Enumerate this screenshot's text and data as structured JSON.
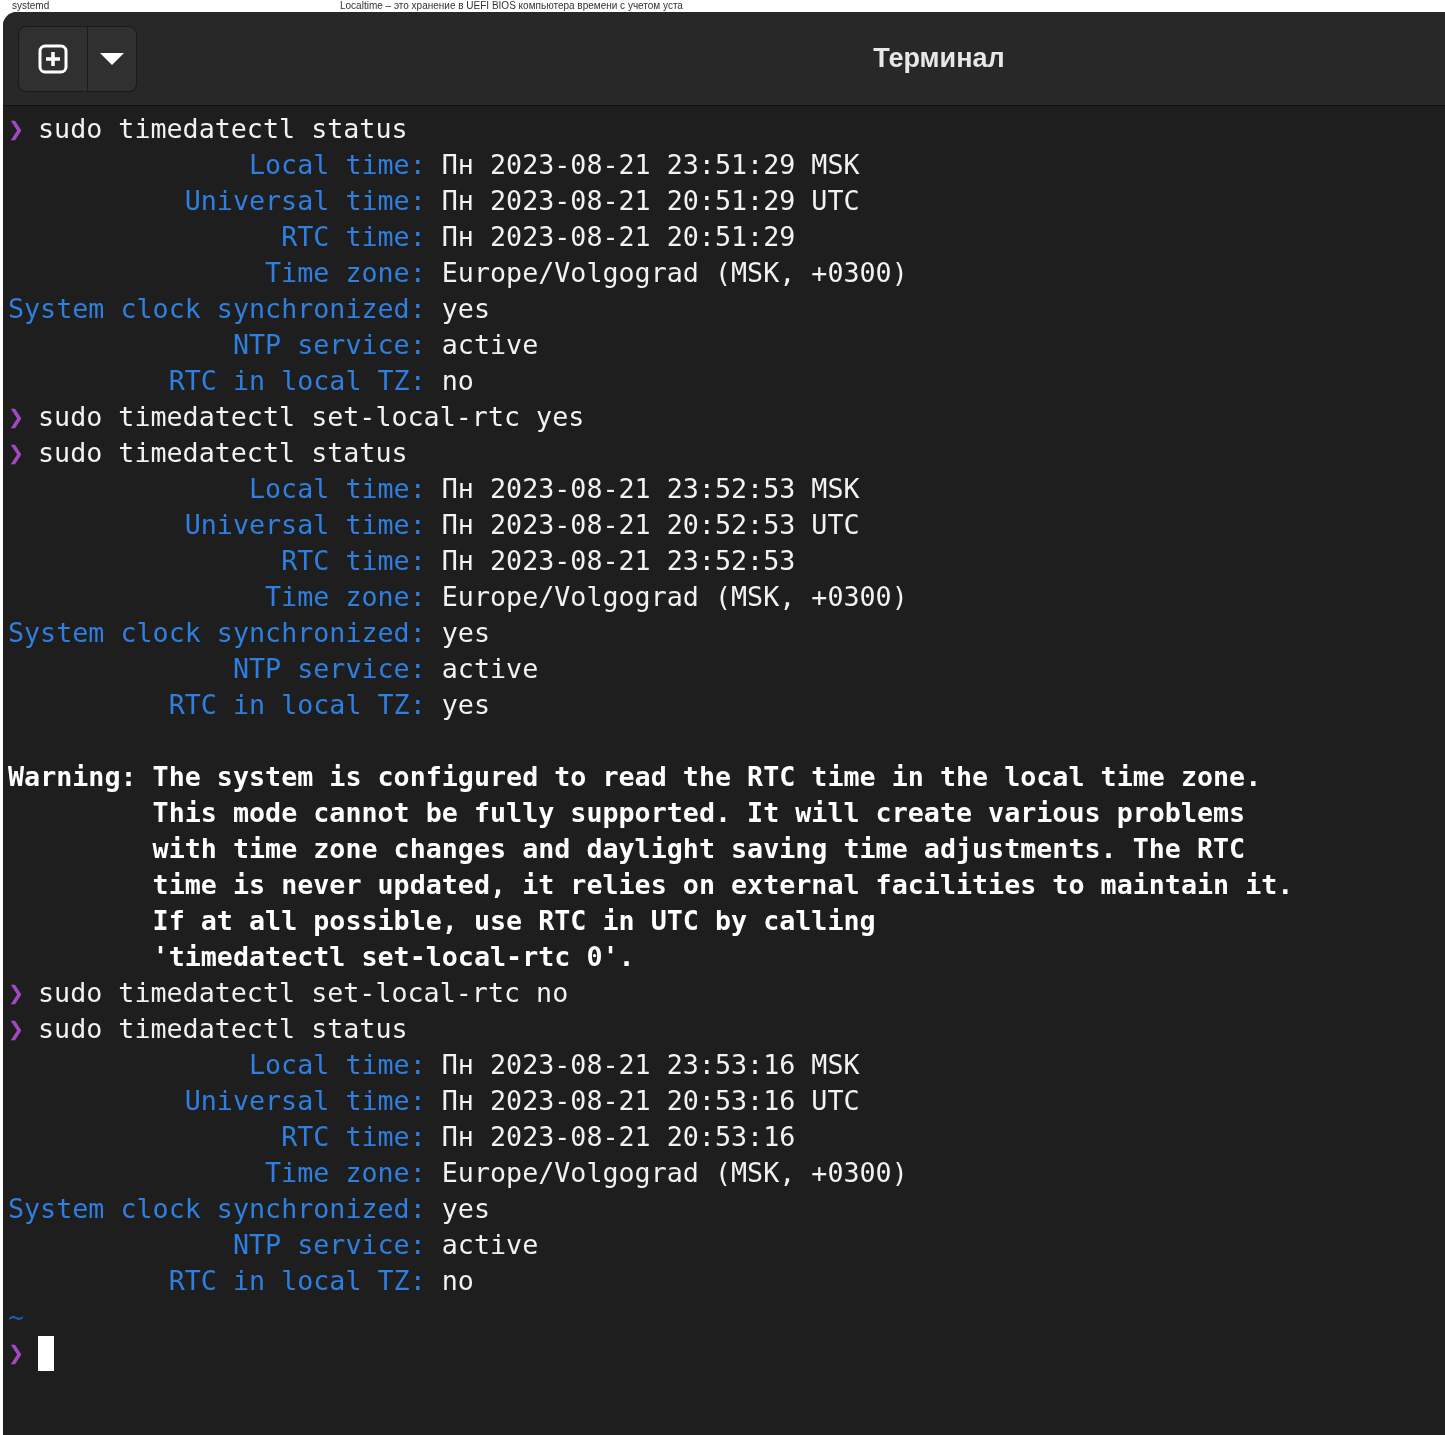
{
  "backdrop": {
    "texts": [
      "systemd",
      "Localtime – это хранение в UEFI BIOS компьютера времени с учетом уста"
    ]
  },
  "window": {
    "title": "Терминал"
  },
  "terminal": {
    "prompt": "❯",
    "lines": [
      {
        "kind": "command",
        "text": "sudo timedatectl status"
      },
      {
        "kind": "field",
        "label": "Local time:",
        "value": "Пн 2023-08-21 23:51:29 MSK"
      },
      {
        "kind": "field",
        "label": "Universal time:",
        "value": "Пн 2023-08-21 20:51:29 UTC"
      },
      {
        "kind": "field",
        "label": "RTC time:",
        "value": "Пн 2023-08-21 20:51:29"
      },
      {
        "kind": "field",
        "label": "Time zone:",
        "value": "Europe/Volgograd (MSK, +0300)"
      },
      {
        "kind": "field",
        "label": "System clock synchronized:",
        "value": "yes"
      },
      {
        "kind": "field",
        "label": "NTP service:",
        "value": "active"
      },
      {
        "kind": "field",
        "label": "RTC in local TZ:",
        "value": "no"
      },
      {
        "kind": "command",
        "text": "sudo timedatectl set-local-rtc yes"
      },
      {
        "kind": "command",
        "text": "sudo timedatectl status"
      },
      {
        "kind": "field",
        "label": "Local time:",
        "value": "Пн 2023-08-21 23:52:53 MSK"
      },
      {
        "kind": "field",
        "label": "Universal time:",
        "value": "Пн 2023-08-21 20:52:53 UTC"
      },
      {
        "kind": "field",
        "label": "RTC time:",
        "value": "Пн 2023-08-21 23:52:53"
      },
      {
        "kind": "field",
        "label": "Time zone:",
        "value": "Europe/Volgograd (MSK, +0300)"
      },
      {
        "kind": "field",
        "label": "System clock synchronized:",
        "value": "yes"
      },
      {
        "kind": "field",
        "label": "NTP service:",
        "value": "active"
      },
      {
        "kind": "field",
        "label": "RTC in local TZ:",
        "value": "yes"
      },
      {
        "kind": "blank"
      },
      {
        "kind": "warning",
        "label": "Warning:",
        "lines": [
          "The system is configured to read the RTC time in the local time zone.",
          "This mode cannot be fully supported. It will create various problems",
          "with time zone changes and daylight saving time adjustments. The RTC",
          "time is never updated, it relies on external facilities to maintain it.",
          "If at all possible, use RTC in UTC by calling",
          "'timedatectl set-local-rtc 0'."
        ]
      },
      {
        "kind": "command",
        "text": "sudo timedatectl set-local-rtc no"
      },
      {
        "kind": "command",
        "text": "sudo timedatectl status"
      },
      {
        "kind": "field",
        "label": "Local time:",
        "value": "Пн 2023-08-21 23:53:16 MSK"
      },
      {
        "kind": "field",
        "label": "Universal time:",
        "value": "Пн 2023-08-21 20:53:16 UTC"
      },
      {
        "kind": "field",
        "label": "RTC time:",
        "value": "Пн 2023-08-21 20:53:16"
      },
      {
        "kind": "field",
        "label": "Time zone:",
        "value": "Europe/Volgograd (MSK, +0300)"
      },
      {
        "kind": "field",
        "label": "System clock synchronized:",
        "value": "yes"
      },
      {
        "kind": "field",
        "label": "NTP service:",
        "value": "active"
      },
      {
        "kind": "field",
        "label": "RTC in local TZ:",
        "value": "no"
      },
      {
        "kind": "cwd",
        "text": "~"
      },
      {
        "kind": "input"
      }
    ]
  }
}
